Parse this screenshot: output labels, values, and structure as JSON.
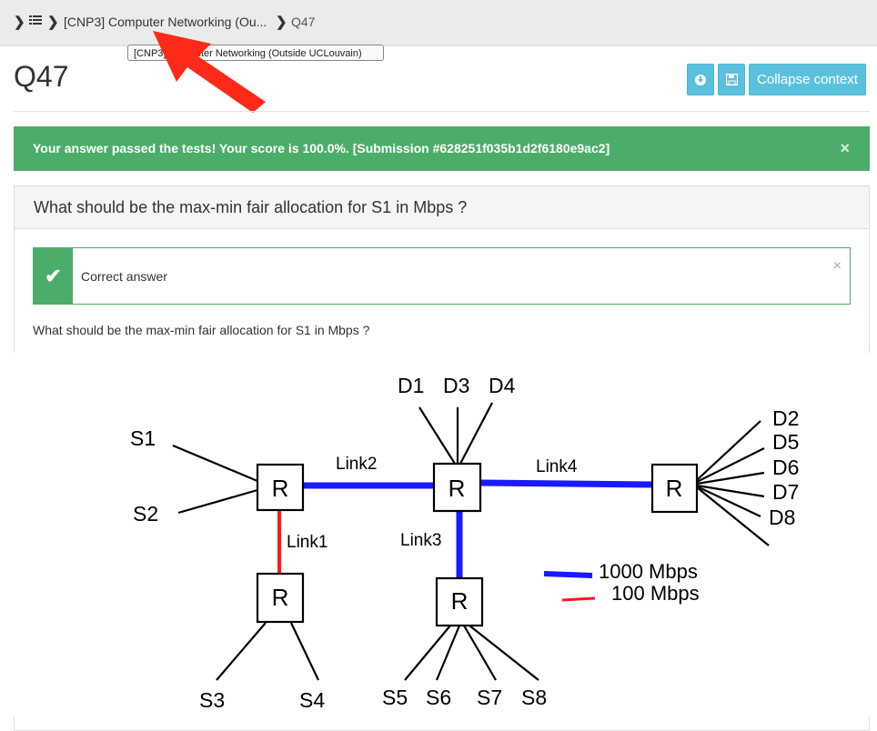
{
  "breadcrumb": {
    "course": "[CNP3] Computer Networking (Ou...",
    "task": "Q47",
    "tooltip": "[CNP3] Computer Networking (Outside UCLouvain)"
  },
  "page": {
    "title": "Q47",
    "collapse_label": "Collapse context"
  },
  "alert": {
    "message": "Your answer passed the tests! Your score is 100.0%. [Submission #628251f035b1d2f6180e9ac2]",
    "close": "×"
  },
  "problem": {
    "header": "What should be the max-min fair allocation for S1 in Mbps ?",
    "feedback": "Correct answer",
    "feedback_close": "×",
    "question": "What should be the max-min fair allocation for S1 in Mbps ?"
  },
  "diagram": {
    "router_label": "R",
    "sources": [
      "S1",
      "S2",
      "S3",
      "S4",
      "S5",
      "S6",
      "S7",
      "S8"
    ],
    "dests_top": [
      "D1",
      "D3",
      "D4"
    ],
    "dests_right": [
      "D2",
      "D5",
      "D6",
      "D7",
      "D8"
    ],
    "links": [
      "Link1",
      "Link2",
      "Link3",
      "Link4"
    ],
    "legend": [
      "1000 Mbps",
      "100 Mbps"
    ],
    "colors": {
      "fast": "#1a1aff",
      "slow": "#ff1a1a"
    }
  },
  "colors": {
    "accent": "#5bc0de",
    "success": "#4cad6a",
    "annotation_arrow": "#ff2a1a"
  }
}
